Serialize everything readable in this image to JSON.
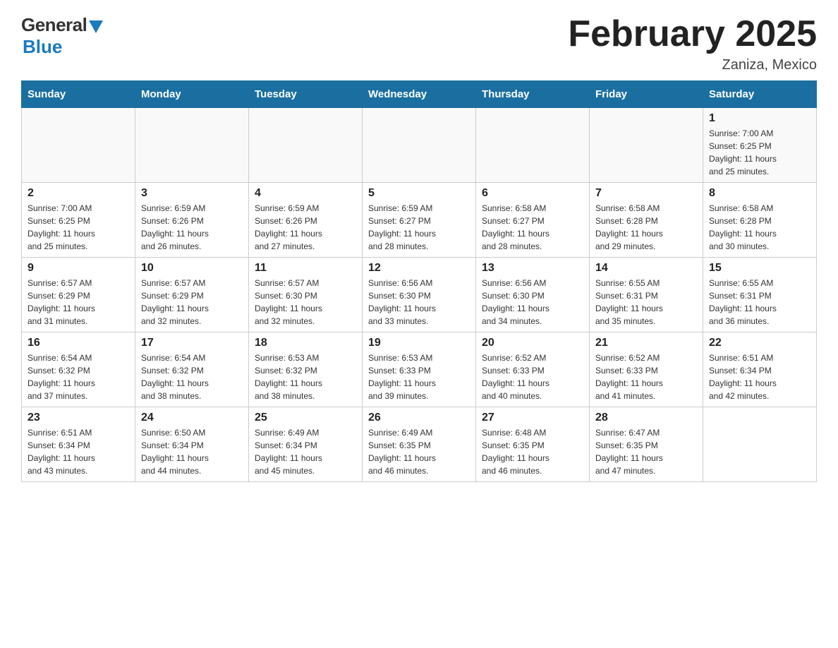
{
  "logo": {
    "general": "General",
    "blue": "Blue"
  },
  "title": "February 2025",
  "location": "Zaniza, Mexico",
  "days_of_week": [
    "Sunday",
    "Monday",
    "Tuesday",
    "Wednesday",
    "Thursday",
    "Friday",
    "Saturday"
  ],
  "weeks": [
    {
      "days": [
        {
          "number": "",
          "info": "",
          "empty": true
        },
        {
          "number": "",
          "info": "",
          "empty": true
        },
        {
          "number": "",
          "info": "",
          "empty": true
        },
        {
          "number": "",
          "info": "",
          "empty": true
        },
        {
          "number": "",
          "info": "",
          "empty": true
        },
        {
          "number": "",
          "info": "",
          "empty": true
        },
        {
          "number": "1",
          "info": "Sunrise: 7:00 AM\nSunset: 6:25 PM\nDaylight: 11 hours\nand 25 minutes.",
          "empty": false
        }
      ]
    },
    {
      "days": [
        {
          "number": "2",
          "info": "Sunrise: 7:00 AM\nSunset: 6:25 PM\nDaylight: 11 hours\nand 25 minutes.",
          "empty": false
        },
        {
          "number": "3",
          "info": "Sunrise: 6:59 AM\nSunset: 6:26 PM\nDaylight: 11 hours\nand 26 minutes.",
          "empty": false
        },
        {
          "number": "4",
          "info": "Sunrise: 6:59 AM\nSunset: 6:26 PM\nDaylight: 11 hours\nand 27 minutes.",
          "empty": false
        },
        {
          "number": "5",
          "info": "Sunrise: 6:59 AM\nSunset: 6:27 PM\nDaylight: 11 hours\nand 28 minutes.",
          "empty": false
        },
        {
          "number": "6",
          "info": "Sunrise: 6:58 AM\nSunset: 6:27 PM\nDaylight: 11 hours\nand 28 minutes.",
          "empty": false
        },
        {
          "number": "7",
          "info": "Sunrise: 6:58 AM\nSunset: 6:28 PM\nDaylight: 11 hours\nand 29 minutes.",
          "empty": false
        },
        {
          "number": "8",
          "info": "Sunrise: 6:58 AM\nSunset: 6:28 PM\nDaylight: 11 hours\nand 30 minutes.",
          "empty": false
        }
      ]
    },
    {
      "days": [
        {
          "number": "9",
          "info": "Sunrise: 6:57 AM\nSunset: 6:29 PM\nDaylight: 11 hours\nand 31 minutes.",
          "empty": false
        },
        {
          "number": "10",
          "info": "Sunrise: 6:57 AM\nSunset: 6:29 PM\nDaylight: 11 hours\nand 32 minutes.",
          "empty": false
        },
        {
          "number": "11",
          "info": "Sunrise: 6:57 AM\nSunset: 6:30 PM\nDaylight: 11 hours\nand 32 minutes.",
          "empty": false
        },
        {
          "number": "12",
          "info": "Sunrise: 6:56 AM\nSunset: 6:30 PM\nDaylight: 11 hours\nand 33 minutes.",
          "empty": false
        },
        {
          "number": "13",
          "info": "Sunrise: 6:56 AM\nSunset: 6:30 PM\nDaylight: 11 hours\nand 34 minutes.",
          "empty": false
        },
        {
          "number": "14",
          "info": "Sunrise: 6:55 AM\nSunset: 6:31 PM\nDaylight: 11 hours\nand 35 minutes.",
          "empty": false
        },
        {
          "number": "15",
          "info": "Sunrise: 6:55 AM\nSunset: 6:31 PM\nDaylight: 11 hours\nand 36 minutes.",
          "empty": false
        }
      ]
    },
    {
      "days": [
        {
          "number": "16",
          "info": "Sunrise: 6:54 AM\nSunset: 6:32 PM\nDaylight: 11 hours\nand 37 minutes.",
          "empty": false
        },
        {
          "number": "17",
          "info": "Sunrise: 6:54 AM\nSunset: 6:32 PM\nDaylight: 11 hours\nand 38 minutes.",
          "empty": false
        },
        {
          "number": "18",
          "info": "Sunrise: 6:53 AM\nSunset: 6:32 PM\nDaylight: 11 hours\nand 38 minutes.",
          "empty": false
        },
        {
          "number": "19",
          "info": "Sunrise: 6:53 AM\nSunset: 6:33 PM\nDaylight: 11 hours\nand 39 minutes.",
          "empty": false
        },
        {
          "number": "20",
          "info": "Sunrise: 6:52 AM\nSunset: 6:33 PM\nDaylight: 11 hours\nand 40 minutes.",
          "empty": false
        },
        {
          "number": "21",
          "info": "Sunrise: 6:52 AM\nSunset: 6:33 PM\nDaylight: 11 hours\nand 41 minutes.",
          "empty": false
        },
        {
          "number": "22",
          "info": "Sunrise: 6:51 AM\nSunset: 6:34 PM\nDaylight: 11 hours\nand 42 minutes.",
          "empty": false
        }
      ]
    },
    {
      "days": [
        {
          "number": "23",
          "info": "Sunrise: 6:51 AM\nSunset: 6:34 PM\nDaylight: 11 hours\nand 43 minutes.",
          "empty": false
        },
        {
          "number": "24",
          "info": "Sunrise: 6:50 AM\nSunset: 6:34 PM\nDaylight: 11 hours\nand 44 minutes.",
          "empty": false
        },
        {
          "number": "25",
          "info": "Sunrise: 6:49 AM\nSunset: 6:34 PM\nDaylight: 11 hours\nand 45 minutes.",
          "empty": false
        },
        {
          "number": "26",
          "info": "Sunrise: 6:49 AM\nSunset: 6:35 PM\nDaylight: 11 hours\nand 46 minutes.",
          "empty": false
        },
        {
          "number": "27",
          "info": "Sunrise: 6:48 AM\nSunset: 6:35 PM\nDaylight: 11 hours\nand 46 minutes.",
          "empty": false
        },
        {
          "number": "28",
          "info": "Sunrise: 6:47 AM\nSunset: 6:35 PM\nDaylight: 11 hours\nand 47 minutes.",
          "empty": false
        },
        {
          "number": "",
          "info": "",
          "empty": true
        }
      ]
    }
  ]
}
